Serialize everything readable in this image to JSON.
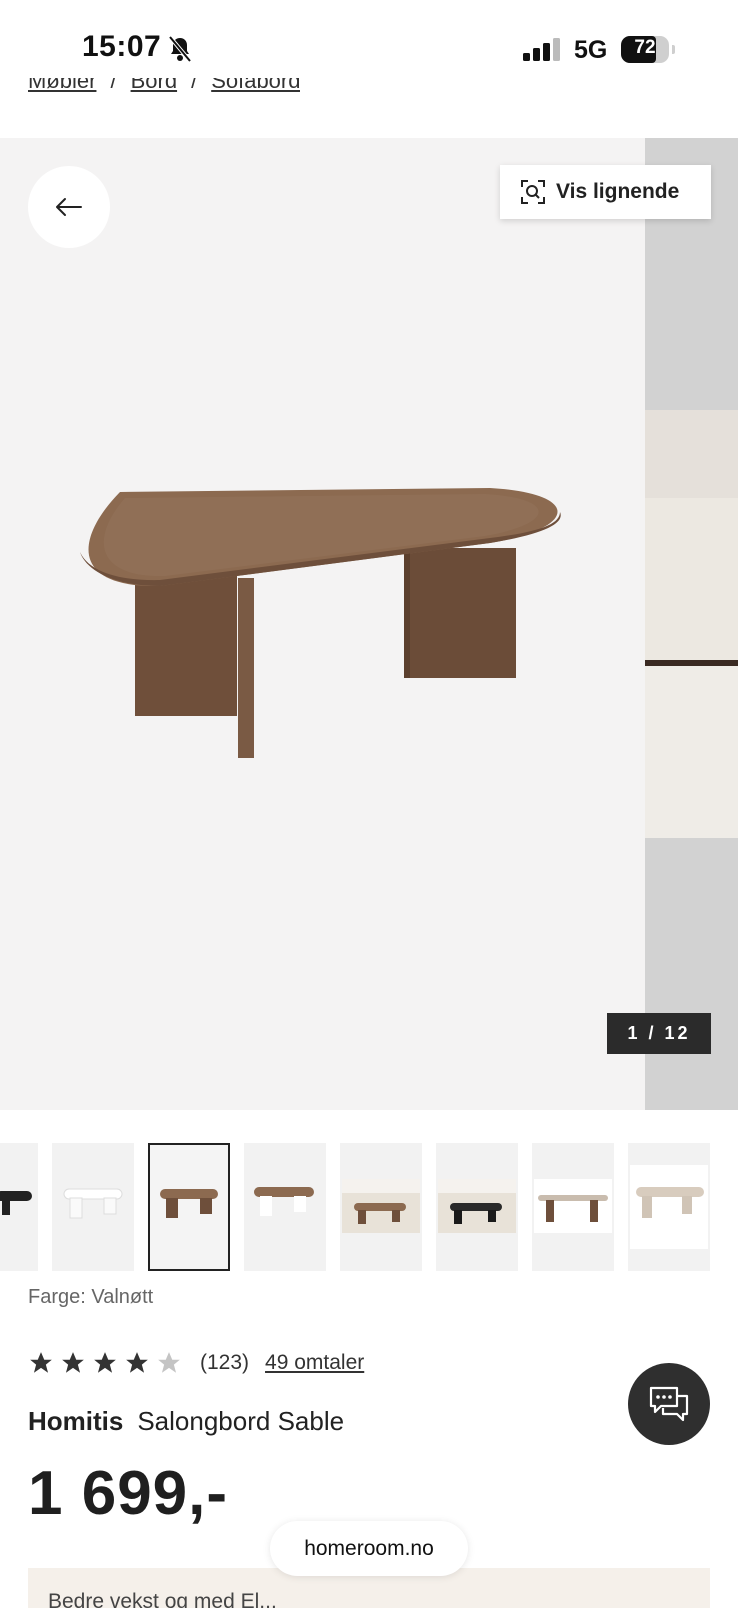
{
  "status_bar": {
    "time": "15:07",
    "network": "5G",
    "battery": "72"
  },
  "breadcrumb": {
    "items": [
      "Møbler",
      "Bord",
      "Sofabord"
    ]
  },
  "gallery": {
    "similar_label": "Vis lignende",
    "counter": "1 / 12"
  },
  "thumbnails": {
    "count": 8,
    "selected_index": 2
  },
  "product": {
    "color_label": "Farge: Valnøtt",
    "rating": 4,
    "rating_max": 5,
    "rating_count": "(123)",
    "reviews_link": "49 omtaler",
    "brand": "Homitis",
    "name": "Salongbord Sable",
    "price": "1 699,-"
  },
  "browser": {
    "url": "homeroom.no"
  },
  "promo": {
    "text": "Bedre vekst og med El..."
  },
  "colors": {
    "accent": "#2b2b2b",
    "wood": "#8c6a50",
    "star": "#333333"
  }
}
